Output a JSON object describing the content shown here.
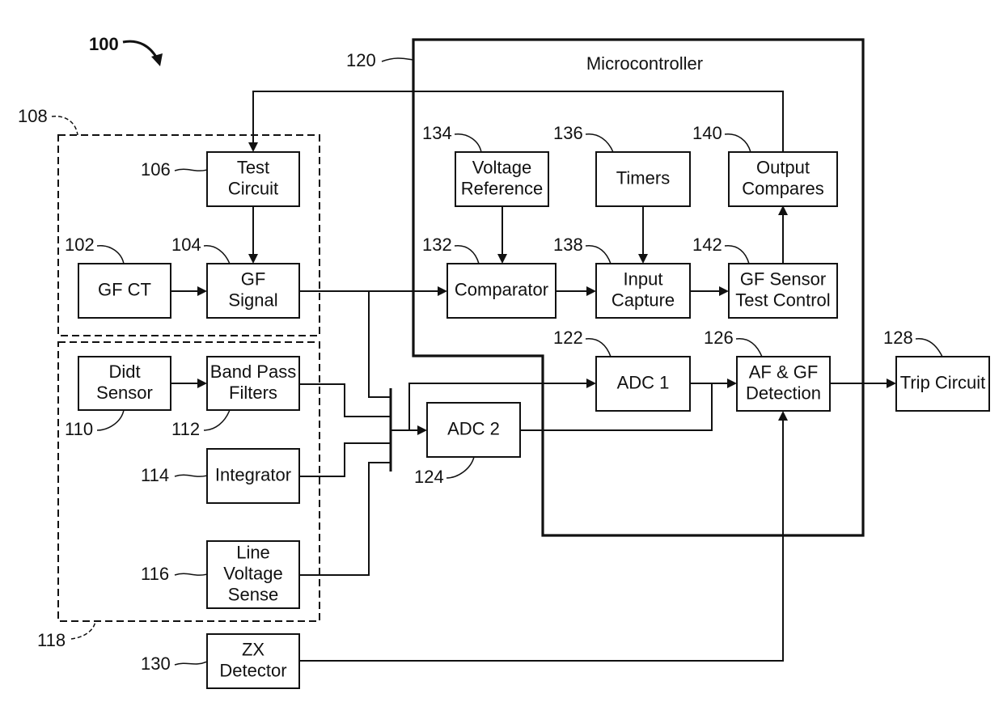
{
  "figure": {
    "ref": "100",
    "microcontroller": {
      "ref": "120",
      "title": "Microcontroller"
    },
    "groups": [
      {
        "id": "gf-group",
        "ref": "108"
      },
      {
        "id": "af-group",
        "ref": "118"
      }
    ],
    "blocks": [
      {
        "id": "test-circuit",
        "ref": "106",
        "lines": [
          "Test",
          "Circuit"
        ]
      },
      {
        "id": "gf-ct",
        "ref": "102",
        "lines": [
          "GF CT"
        ]
      },
      {
        "id": "gf-signal",
        "ref": "104",
        "lines": [
          "GF",
          "Signal"
        ]
      },
      {
        "id": "didt-sensor",
        "ref": "110",
        "lines": [
          "Didt",
          "Sensor"
        ]
      },
      {
        "id": "band-pass-filters",
        "ref": "112",
        "lines": [
          "Band Pass",
          "Filters"
        ]
      },
      {
        "id": "integrator",
        "ref": "114",
        "lines": [
          "Integrator"
        ]
      },
      {
        "id": "line-voltage-sense",
        "ref": "116",
        "lines": [
          "Line",
          "Voltage",
          "Sense"
        ]
      },
      {
        "id": "zx-detector",
        "ref": "130",
        "lines": [
          "ZX",
          "Detector"
        ]
      },
      {
        "id": "voltage-reference",
        "ref": "134",
        "lines": [
          "Voltage",
          "Reference"
        ]
      },
      {
        "id": "timers",
        "ref": "136",
        "lines": [
          "Timers"
        ]
      },
      {
        "id": "output-compares",
        "ref": "140",
        "lines": [
          "Output",
          "Compares"
        ]
      },
      {
        "id": "comparator",
        "ref": "132",
        "lines": [
          "Comparator"
        ]
      },
      {
        "id": "input-capture",
        "ref": "138",
        "lines": [
          "Input",
          "Capture"
        ]
      },
      {
        "id": "gf-sensor-test-control",
        "ref": "142",
        "lines": [
          "GF Sensor",
          "Test Control"
        ]
      },
      {
        "id": "adc-1",
        "ref": "122",
        "lines": [
          "ADC 1"
        ]
      },
      {
        "id": "adc-2",
        "ref": "124",
        "lines": [
          "ADC 2"
        ]
      },
      {
        "id": "af-gf-detection",
        "ref": "126",
        "lines": [
          "AF & GF",
          "Detection"
        ]
      },
      {
        "id": "trip-circuit",
        "ref": "128",
        "lines": [
          "Trip Circuit"
        ]
      }
    ],
    "connections": [
      {
        "from": "output-compares",
        "to": "test-circuit"
      },
      {
        "from": "test-circuit",
        "to": "gf-signal"
      },
      {
        "from": "gf-ct",
        "to": "gf-signal"
      },
      {
        "from": "gf-signal",
        "to": "comparator"
      },
      {
        "from": "gf-signal",
        "to": "bus"
      },
      {
        "from": "didt-sensor",
        "to": "band-pass-filters"
      },
      {
        "from": "band-pass-filters",
        "to": "bus"
      },
      {
        "from": "integrator",
        "to": "bus"
      },
      {
        "from": "line-voltage-sense",
        "to": "bus"
      },
      {
        "from": "bus",
        "to": "adc-1"
      },
      {
        "from": "bus",
        "to": "adc-2"
      },
      {
        "from": "voltage-reference",
        "to": "comparator"
      },
      {
        "from": "comparator",
        "to": "input-capture"
      },
      {
        "from": "timers",
        "to": "input-capture"
      },
      {
        "from": "input-capture",
        "to": "gf-sensor-test-control"
      },
      {
        "from": "gf-sensor-test-control",
        "to": "output-compares"
      },
      {
        "from": "adc-1",
        "to": "af-gf-detection"
      },
      {
        "from": "adc-2",
        "to": "af-gf-detection"
      },
      {
        "from": "zx-detector",
        "to": "af-gf-detection"
      },
      {
        "from": "af-gf-detection",
        "to": "trip-circuit"
      }
    ]
  }
}
